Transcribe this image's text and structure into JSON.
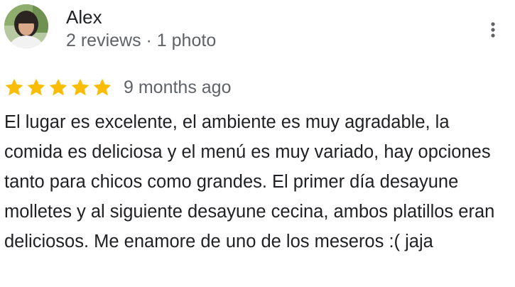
{
  "author": {
    "name": "Alex",
    "meta": "2 reviews · 1 photo",
    "avatar": "profile-photo"
  },
  "rating": {
    "stars": 5,
    "max": 5,
    "star_color": "#fbbc04",
    "date": "9 months ago"
  },
  "review": {
    "text": "El lugar es excelente, el ambiente es muy agradable, la comida es deliciosa y el menú es muy variado, hay opciones tanto para chicos como grandes. El primer día desayune molletes y al siguiente desayune cecina, ambos platillos eran deliciosos. Me enamore de uno de los meseros :( jaja"
  },
  "icons": {
    "more": "more-vertical-icon",
    "star": "star-icon"
  }
}
